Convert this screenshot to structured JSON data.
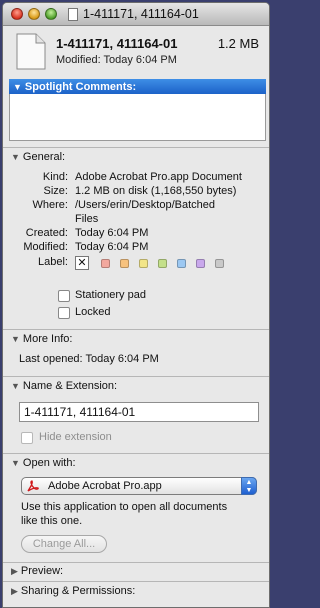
{
  "window": {
    "title": "1-411171, 411164-01"
  },
  "header": {
    "file_name": "1-411171, 411164-01",
    "file_size": "1.2 MB",
    "modified": "Modified: Today 6:04 PM"
  },
  "spotlight": {
    "heading": "Spotlight Comments:",
    "comment": ""
  },
  "general": {
    "heading": "General:",
    "kind_label": "Kind:",
    "kind": "Adobe Acrobat Pro.app Document",
    "size_label": "Size:",
    "size": "1.2 MB on disk (1,168,550 bytes)",
    "where_label": "Where:",
    "where_line1": "/Users/erin/Desktop/Batched",
    "where_line2": "Files",
    "created_label": "Created:",
    "created": "Today 6:04 PM",
    "modified_label": "Modified:",
    "modified": "Today 6:04 PM",
    "label_label": "Label:",
    "label_none": "✕",
    "label_colors": [
      "#f2a89e",
      "#f7c27e",
      "#f2e588",
      "#c4e08a",
      "#9cc8f2",
      "#c9a8ec",
      "#c9c9c9"
    ],
    "stationery_pad": "Stationery pad",
    "locked": "Locked"
  },
  "more_info": {
    "heading": "More Info:",
    "last_opened": "Last opened: Today 6:04 PM"
  },
  "name_extension": {
    "heading": "Name & Extension:",
    "name_value": "1-411171, 411164-01",
    "hide_extension": "Hide extension"
  },
  "open_with": {
    "heading": "Open with:",
    "app": "Adobe Acrobat Pro.app",
    "description_line1": "Use this application to open all documents",
    "description_line2": "like this one.",
    "change_all": "Change All..."
  },
  "preview": {
    "heading": "Preview:"
  },
  "sharing": {
    "heading": "Sharing & Permissions:"
  },
  "icons": {
    "close": "close-button",
    "minimize": "minimize-button",
    "zoom": "zoom-button",
    "document": "document-icon",
    "pdf": "acrobat-pdf-icon"
  }
}
